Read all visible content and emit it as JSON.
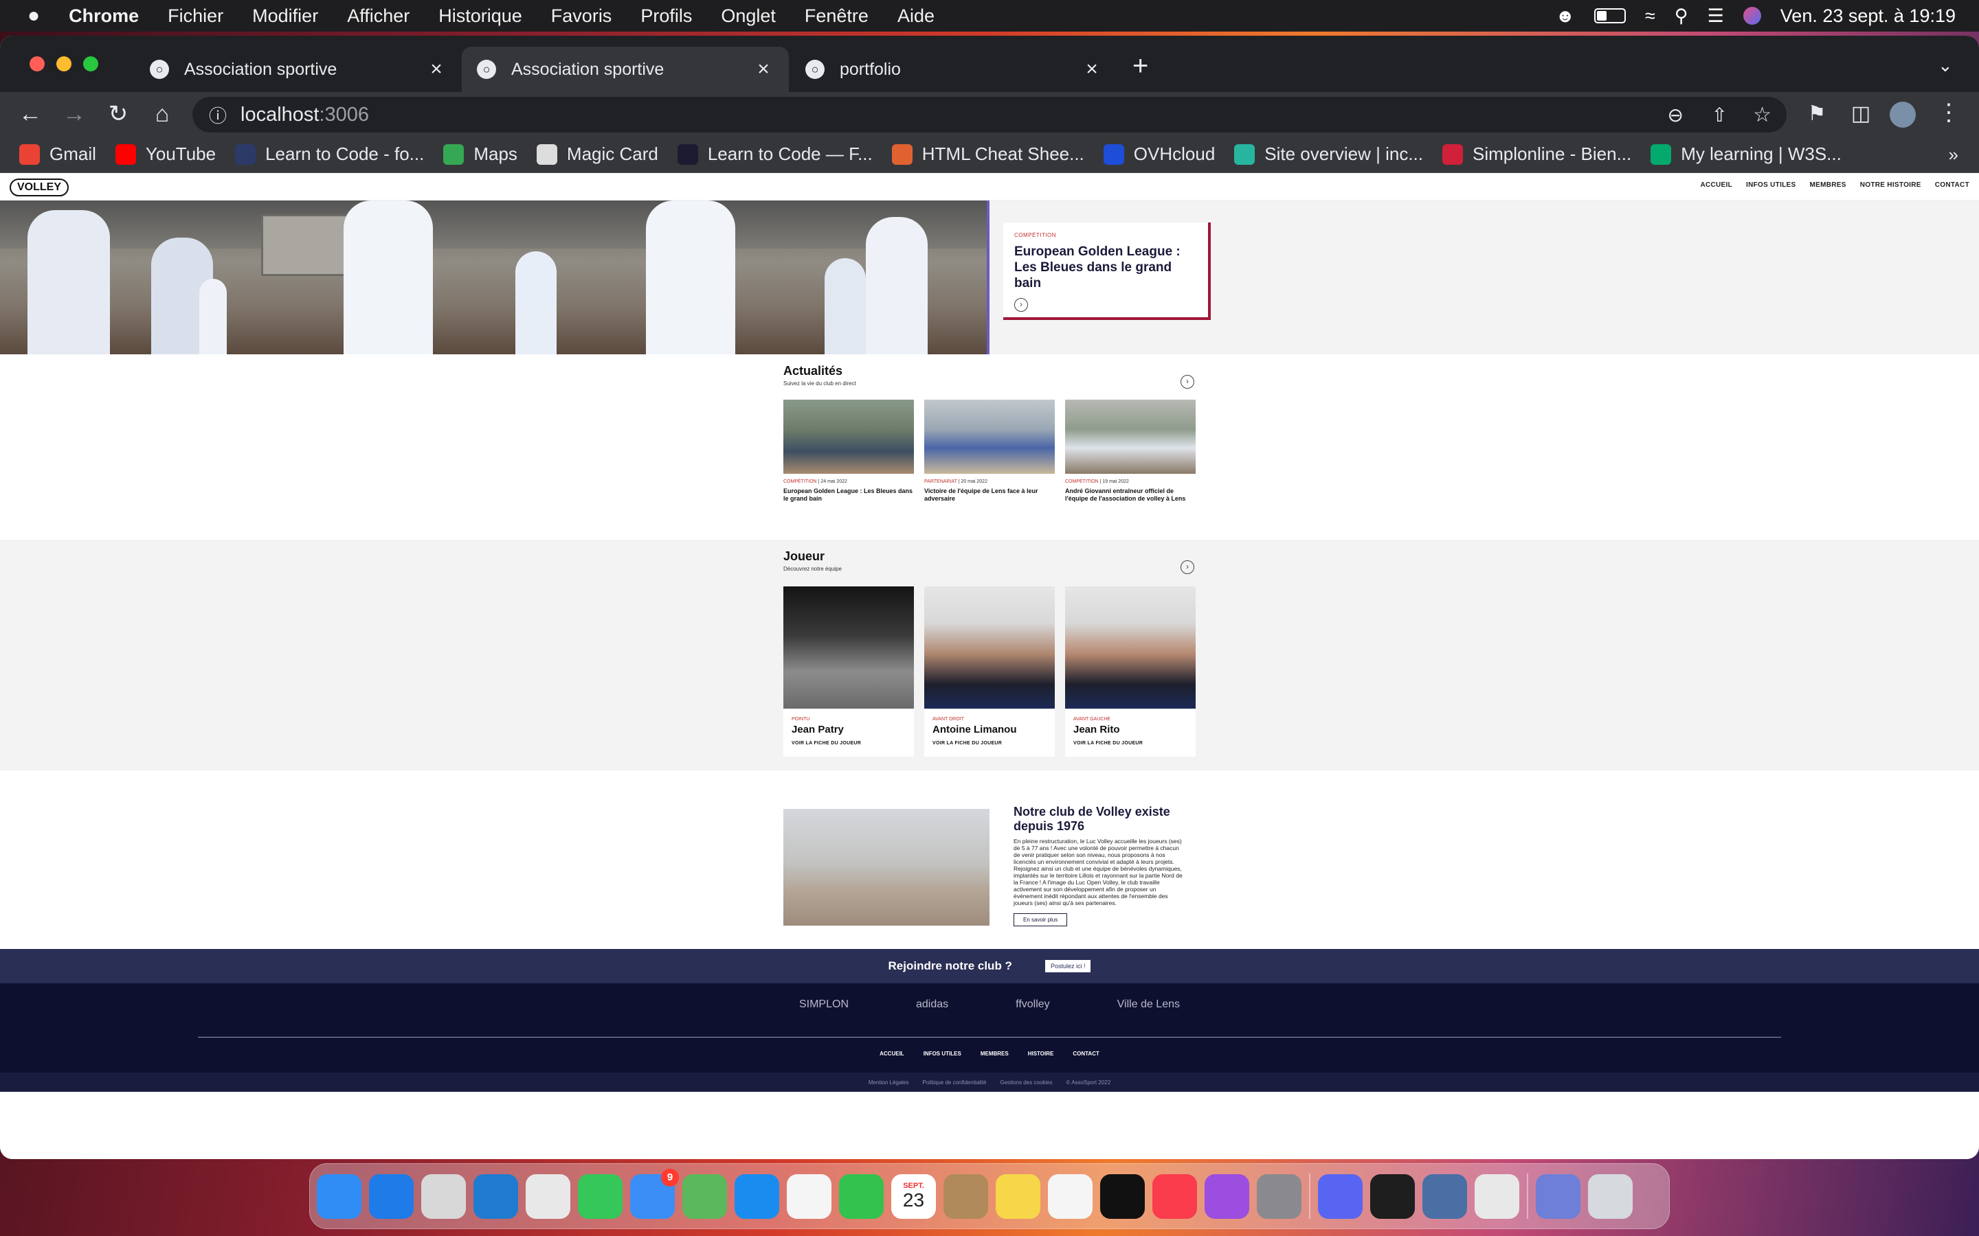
{
  "menubar": {
    "apple": "",
    "app": "Chrome",
    "items": [
      "Fichier",
      "Modifier",
      "Afficher",
      "Historique",
      "Favoris",
      "Profils",
      "Onglet",
      "Fenêtre",
      "Aide"
    ],
    "clock": "Ven. 23 sept. à  19:19"
  },
  "browser": {
    "tabs": [
      {
        "label": "Association sportive",
        "active": false
      },
      {
        "label": "Association sportive",
        "active": true
      },
      {
        "label": "portfolio",
        "active": false
      }
    ],
    "new_tab": "+",
    "url_host": "localhost",
    "url_port": ":3006",
    "bookmarks": [
      {
        "label": "Gmail",
        "color": "#ea4335"
      },
      {
        "label": "YouTube",
        "color": "#ff0000"
      },
      {
        "label": "Learn to Code - fo...",
        "color": "#2b3a67"
      },
      {
        "label": "Maps",
        "color": "#34a853"
      },
      {
        "label": "Magic Card",
        "color": "#dddddd"
      },
      {
        "label": "Learn to Code — F...",
        "color": "#1b1b32"
      },
      {
        "label": "HTML Cheat Shee...",
        "color": "#e06230"
      },
      {
        "label": "OVHcloud",
        "color": "#1e4dd8"
      },
      {
        "label": "Site overview | inc...",
        "color": "#27b5a0"
      },
      {
        "label": "Simplonline - Bien...",
        "color": "#d0203a"
      },
      {
        "label": "My learning | W3S...",
        "color": "#04aa6d"
      }
    ],
    "bookmarks_more": "»"
  },
  "site": {
    "logo": "VOLLEY",
    "nav": [
      "ACCUEIL",
      "INFOS UTILES",
      "MEMBRES",
      "NOTRE HISTOIRE",
      "CONTACT"
    ],
    "hero": {
      "category": "COMPÉTITION",
      "title": "European Golden League : Les Bleues dans le grand bain"
    },
    "news": {
      "title": "Actualités",
      "subtitle": "Suivez la vie du club en direct",
      "items": [
        {
          "category": "COMPÉTITION",
          "date": "24 mai 2022",
          "title": "European Golden League : Les Bleues dans le grand bain"
        },
        {
          "category": "PARTENARIAT",
          "date": "20 mai 2022",
          "title": "Victoire de l'équipe de Lens face à leur adversaire"
        },
        {
          "category": "COMPÉTITION",
          "date": "19 mai 2022",
          "title": "André Giovanni entraîneur officiel de l'équipe de l'association de volley à Lens"
        }
      ]
    },
    "players": {
      "title": "Joueur",
      "subtitle": "Découvrez notre équipe",
      "items": [
        {
          "position": "POINTU",
          "name": "Jean Patry",
          "link": "VOIR LA FICHE DU JOUEUR"
        },
        {
          "position": "AVANT DROIT",
          "name": "Antoine Limanou",
          "link": "VOIR LA FICHE DU JOUEUR"
        },
        {
          "position": "AVANT GAUCHE",
          "name": "Jean Rito",
          "link": "VOIR LA FICHE DU JOUEUR"
        }
      ]
    },
    "club": {
      "title": "Notre club de Volley existe depuis 1976",
      "text": "En pleine restructuration, le Luc Volley accueille les joueurs (ses) de 5 à 77 ans ! Avec une volonté de pouvoir permettre à chacun de venir pratiquer selon son niveau, nous proposons à nos licenciés un environnement convivial et adapté à leurs projets. Rejoignez ainsi un club et une équipe de bénévoles dynamiques, implantés sur le territoire Lillois et rayonnant sur la partie Nord de la France ! A l'image du Luc Open Volley, le club travaille activement sur son développement afin de proposer un événement inédit répondant aux attentes de l'ensemble des joueurs (ses) ainsi qu'à ses partenaires.",
      "button": "En savoir plus"
    },
    "join": {
      "text": "Rejoindre notre club ?",
      "button": "Postulez ici !"
    },
    "sponsors": [
      "SIMPLON",
      "adidas",
      "ffvolley",
      "Ville de Lens"
    ],
    "footer_links": [
      "ACCUEIL",
      "INFOS UTILES",
      "MEMBRES",
      "HISTOIRE",
      "CONTACT"
    ],
    "legal": [
      "Mention Légales",
      "Politique de confidentialité",
      "Gestions des cookies",
      "© AssoSport 2022"
    ]
  },
  "dock": {
    "apps": [
      {
        "name": "finder",
        "color": "#2f8df5"
      },
      {
        "name": "safari",
        "color": "#1e7be8"
      },
      {
        "name": "launchpad",
        "color": "#d8d8d8"
      },
      {
        "name": "vscode",
        "color": "#1f7bd0"
      },
      {
        "name": "chrome",
        "color": "#e8e8e8"
      },
      {
        "name": "messages",
        "color": "#35c759"
      },
      {
        "name": "mail",
        "color": "#3a8ef5",
        "badge": "9"
      },
      {
        "name": "maps",
        "color": "#5cb85c"
      },
      {
        "name": "app-store",
        "color": "#1a8cf0"
      },
      {
        "name": "photos",
        "color": "#f5f5f5"
      },
      {
        "name": "facetime",
        "color": "#33c24d"
      },
      {
        "name": "calendar",
        "color": "#ffffff",
        "label": "23"
      },
      {
        "name": "contacts",
        "color": "#b08a5a"
      },
      {
        "name": "notes",
        "color": "#f7d64a"
      },
      {
        "name": "reminders",
        "color": "#f5f5f5"
      },
      {
        "name": "apple-tv",
        "color": "#111111"
      },
      {
        "name": "music",
        "color": "#fa3c4c"
      },
      {
        "name": "podcasts",
        "color": "#9b4ee0"
      },
      {
        "name": "system-settings",
        "color": "#8a8a8e"
      },
      {
        "name": "discord",
        "color": "#5865f2"
      },
      {
        "name": "figma",
        "color": "#1e1e1e"
      },
      {
        "name": "preview",
        "color": "#4a6fa5"
      },
      {
        "name": "chrome-2",
        "color": "#e8e8e8"
      },
      {
        "name": "downloads",
        "color": "#6e7fd8"
      },
      {
        "name": "trash",
        "color": "#d6d9dd"
      }
    ],
    "calendar_month": "SEPT."
  }
}
